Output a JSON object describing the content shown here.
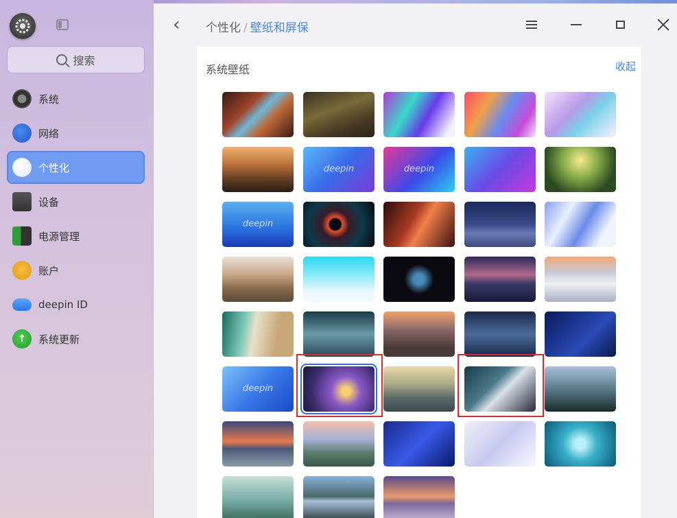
{
  "sidebar": {
    "search_placeholder": "搜索",
    "items": [
      {
        "label": "系统",
        "icon": "system-icon",
        "active": false
      },
      {
        "label": "网络",
        "icon": "network-icon",
        "active": false
      },
      {
        "label": "个性化",
        "icon": "personalization-icon",
        "active": true
      },
      {
        "label": "设备",
        "icon": "device-icon",
        "active": false
      },
      {
        "label": "电源管理",
        "icon": "power-icon",
        "active": false
      },
      {
        "label": "账户",
        "icon": "account-icon",
        "active": false
      },
      {
        "label": "deepin ID",
        "icon": "cloud-icon",
        "active": false
      },
      {
        "label": "系统更新",
        "icon": "update-icon",
        "active": false
      }
    ]
  },
  "header": {
    "breadcrumb_parent": "个性化",
    "breadcrumb_separator": "/",
    "breadcrumb_current": "壁纸和屏保"
  },
  "section": {
    "title": "系统壁纸",
    "collapse_label": "收起"
  },
  "wallpapers": [
    {
      "name": "canyon-arch",
      "bg": "linear-gradient(135deg,#3a1a14 0%,#a0452a 35%,#6fb8d8 50%,#c06a3a 65%,#3b1a12 100%)"
    },
    {
      "name": "autumn-forest",
      "bg": "linear-gradient(160deg,#3b3020,#7a6a3a 40%,#4a3b24 70%,#2b2418)"
    },
    {
      "name": "aurora-gradient",
      "bg": "linear-gradient(120deg,#b23ad8,#3ad8c8 35%,#6a3ae8 60%,#f2f0ff 90%)"
    },
    {
      "name": "rainbow-prism",
      "bg": "linear-gradient(120deg,#ff4a6a,#f0a04a 30%,#6a8af0 55%,#c84ad8 80%,#f2e0ff)"
    },
    {
      "name": "pastel-glass",
      "bg": "linear-gradient(135deg,#f4e2ff,#b89ae8 40%,#7ad0e8 60%,#f8f0ff)"
    },
    {
      "name": "mountain-sunset",
      "bg": "linear-gradient(180deg,#f0b070,#b8703a 40%,#5a3a22 75%,#2a1e16)"
    },
    {
      "name": "deepin-blue-wave",
      "bg": "linear-gradient(135deg,#5ab8f8,#3a6ae8 50%,#7a3ad8)",
      "text": "deepin"
    },
    {
      "name": "deepin-magenta-wave",
      "bg": "linear-gradient(135deg,#e83a9a,#3a4ae8 55%,#2ad0f0)",
      "text": "deepin"
    },
    {
      "name": "deepin-logo-purple",
      "bg": "linear-gradient(135deg,#3ab0f0,#6a4ae8 50%,#c83ad8)"
    },
    {
      "name": "green-valley",
      "bg": "radial-gradient(circle at 50% 30%,#f8e890 0%,#8ab04a 35%,#2a4a22 75%)"
    },
    {
      "name": "deepin-mascot",
      "bg": "linear-gradient(180deg,#5ab0f0,#2a70e0 60%,#1a3ab0)",
      "text": "deepin"
    },
    {
      "name": "dark-lens",
      "bg": "radial-gradient(circle at 45% 50%,#0a0a12 0 12%,#e0502a 16%,#3a1a2a 30%,#0e3a4a 60%,#0a0a0e)"
    },
    {
      "name": "antelope-canyon",
      "bg": "linear-gradient(120deg,#2a0e0a,#a83a22 40%,#f0804a 55%,#3a1210)"
    },
    {
      "name": "night-desert",
      "bg": "linear-gradient(180deg,#1a2a5a,#3a4a8a 50%,#6a7ab8 70%,#3a4a7a)"
    },
    {
      "name": "light-beams",
      "bg": "linear-gradient(120deg,#8aa0f0,#e8f0ff 30%,#6a8ae8 55%,#f0f4ff 80%)"
    },
    {
      "name": "sand-dunes",
      "bg": "linear-gradient(180deg,#e8e0d8,#c8a888 40%,#8a6a4a 70%,#5a4a3a)"
    },
    {
      "name": "white-pyramid",
      "bg": "linear-gradient(180deg,#2ad8f0,#8ae8f8 40%,#f0f8ff 80%)"
    },
    {
      "name": "dark-fish",
      "bg": "radial-gradient(circle at 50% 50%,#4a8ab8 0 12%,#0a0a10 35%)"
    },
    {
      "name": "lake-mountains",
      "bg": "linear-gradient(180deg,#2a2a5a,#b06a8a 40%,#3a3a6a 60%,#1a1a3a)"
    },
    {
      "name": "snow-peaks",
      "bg": "linear-gradient(180deg,#f0a878,#c8c8d8 35%,#f0f0f4 60%,#a8b0c8)"
    },
    {
      "name": "beach-aerial",
      "bg": "linear-gradient(100deg,#1a6a5a,#7ac8b8 30%,#e8e0c8 45%,#c8a878 75%)"
    },
    {
      "name": "teal-hills",
      "bg": "linear-gradient(180deg,#1a3a4a,#6a9aa8 50%,#2a4a5a)"
    },
    {
      "name": "dune-dusk",
      "bg": "linear-gradient(180deg,#f0a06a,#8a6a6a 40%,#4a3a3a 80%)"
    },
    {
      "name": "blue-dunes",
      "bg": "linear-gradient(180deg,#1a2a4a,#4a6a9a 50%,#1a2a4a)"
    },
    {
      "name": "deepin-navy",
      "bg": "linear-gradient(135deg,#0a1a5a,#2a4ab8 60%,#0a1a4a)"
    },
    {
      "name": "deepin-sky",
      "bg": "linear-gradient(135deg,#7ac0f8,#3a7ae8 50%,#1a4ac8)",
      "text": "deepin"
    },
    {
      "name": "anime-violet",
      "bg": "radial-gradient(circle at 60% 55%,#f8d070 0 8%,#8a5ac8 30%,#3a2a6a 70%,#1a1a3a)"
    },
    {
      "name": "reflection-lake",
      "bg": "linear-gradient(180deg,#e8d8a8,#a8a888 40%,#5a6a6a 70%,#3a4a4a)"
    },
    {
      "name": "anime-silver",
      "bg": "linear-gradient(135deg,#1a3a4a,#4a7a8a 40%,#d8e0e8 55%,#2a2a3a)"
    },
    {
      "name": "misty-forest",
      "bg": "linear-gradient(180deg,#a8c0d8,#5a7a8a 50%,#1a2a2a)"
    },
    {
      "name": "sunset-shore",
      "bg": "linear-gradient(180deg,#3a4a7a,#e87a4a 45%,#4a5a7a 60%,#8a9aa8)"
    },
    {
      "name": "alpine-pastel",
      "bg": "linear-gradient(180deg,#f0c0a8,#a8b0d8 40%,#5a7a6a 70%,#3a5a4a)"
    },
    {
      "name": "deepin-deep-blue",
      "bg": "linear-gradient(135deg,#1a2a8a,#3a5ae8 50%,#0a1a6a)"
    },
    {
      "name": "white-waves",
      "bg": "linear-gradient(135deg,#f0f0f8,#c8c8f0 50%,#f8f8ff)"
    },
    {
      "name": "teal-water",
      "bg": "radial-gradient(circle at 50% 50%,#b8f0f8 0 12%,#3ab0c8 40%,#0a5a7a)"
    },
    {
      "name": "waterfall-mist",
      "bg": "linear-gradient(180deg,#c8e0d8,#7ab0a8 50%,#3a6a5a)"
    },
    {
      "name": "mountain-lake-reflection",
      "bg": "linear-gradient(180deg,#8ab0d8,#4a6a6a 45%,#a8c0d8 55%,#2a3a3a)"
    },
    {
      "name": "purple-shore",
      "bg": "linear-gradient(180deg,#5a4a8a,#e89a6a 45%,#7a6a9a 60%,#c8b8d8)"
    }
  ]
}
